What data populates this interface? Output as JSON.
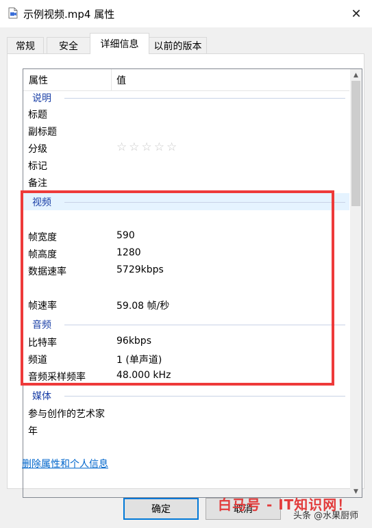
{
  "window": {
    "title": "示例视频.mp4 属性",
    "close_glyph": "✕"
  },
  "tabs": [
    {
      "label": "常规"
    },
    {
      "label": "安全"
    },
    {
      "label": "详细信息"
    },
    {
      "label": "以前的版本"
    }
  ],
  "table": {
    "col_property": "属性",
    "col_value": "值"
  },
  "groups": {
    "description": "说明",
    "video": "视频",
    "audio": "音频",
    "media": "媒体"
  },
  "description_rows": [
    {
      "key": "标题",
      "value": ""
    },
    {
      "key": "副标题",
      "value": ""
    },
    {
      "key": "分级",
      "value": ""
    },
    {
      "key": "标记",
      "value": ""
    },
    {
      "key": "备注",
      "value": ""
    }
  ],
  "rating": {
    "stars": "☆☆☆☆☆",
    "value": 0,
    "max": 5
  },
  "video_rows": [
    {
      "key": "帧宽度",
      "value": "590"
    },
    {
      "key": "帧高度",
      "value": "1280"
    },
    {
      "key": "数据速率",
      "value": "5729kbps"
    },
    {
      "key": "帧速率",
      "value": "59.08 帧/秒"
    }
  ],
  "audio_rows": [
    {
      "key": "比特率",
      "value": "96kbps"
    },
    {
      "key": "频道",
      "value": "1 (单声道)"
    },
    {
      "key": "音频采样频率",
      "value": "48.000 kHz"
    }
  ],
  "media_rows": [
    {
      "key": "参与创作的艺术家",
      "value": ""
    },
    {
      "key": "年",
      "value": ""
    }
  ],
  "link": "删除属性和个人信息",
  "buttons": {
    "ok": "确定",
    "cancel": "取消"
  },
  "watermark": {
    "main": "白马号 - IT知识网！",
    "sub": "头条 @水果厨师"
  },
  "colors": {
    "highlight": "#ee3a3a",
    "group_text": "#1a3fa6",
    "link": "#0066cc",
    "default_button_border": "#0078d7"
  }
}
